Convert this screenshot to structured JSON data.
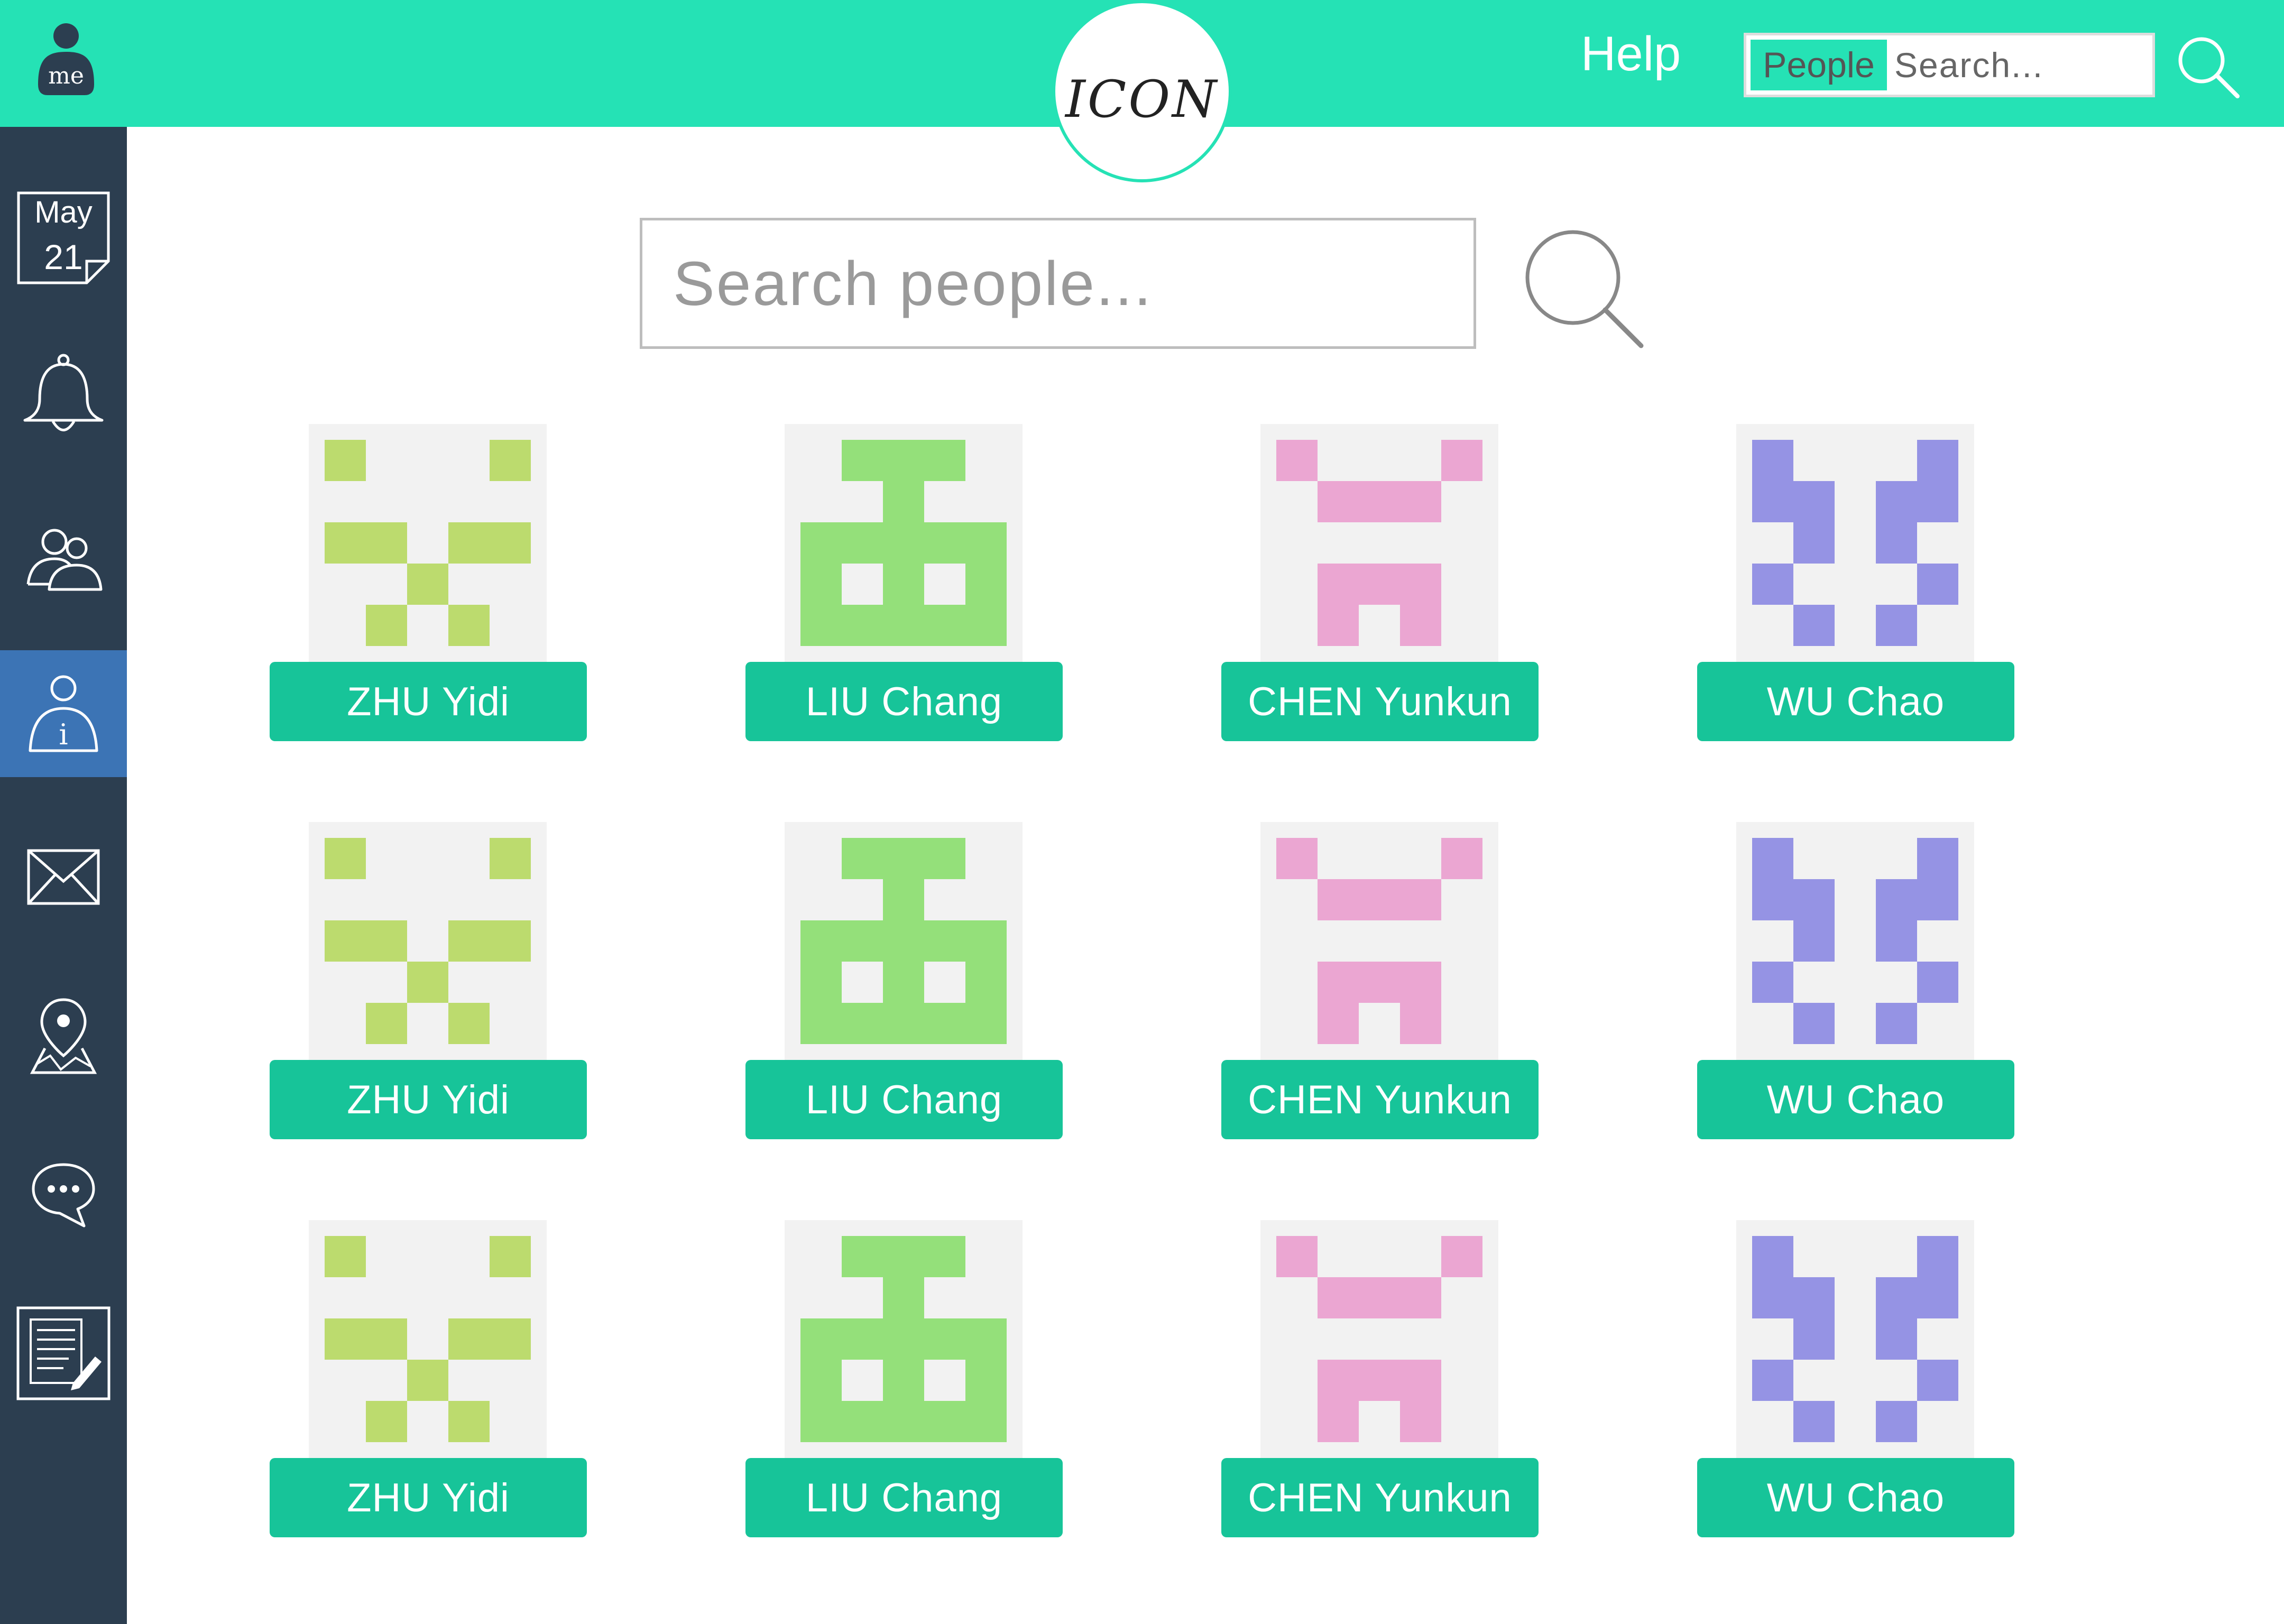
{
  "header": {
    "avatar_label": "me",
    "logo_text": "ICON",
    "help_label": "Help",
    "search": {
      "scope": "People",
      "placeholder": "Search..."
    }
  },
  "sidebar": {
    "calendar": {
      "month": "May",
      "day": "21"
    },
    "items": [
      {
        "icon": "calendar-icon",
        "active": false
      },
      {
        "icon": "bell-icon",
        "active": false
      },
      {
        "icon": "people-icon",
        "active": false
      },
      {
        "icon": "person-info-icon",
        "active": true
      },
      {
        "icon": "mail-icon",
        "active": false
      },
      {
        "icon": "map-pin-icon",
        "active": false
      },
      {
        "icon": "chat-icon",
        "active": false
      },
      {
        "icon": "edit-document-icon",
        "active": false
      }
    ]
  },
  "main": {
    "search_placeholder": "Search people...",
    "people_rows": [
      [
        {
          "name": "ZHU Yidi"
        },
        {
          "name": "LIU Chang"
        },
        {
          "name": "CHEN Yunkun"
        },
        {
          "name": "WU Chao"
        }
      ],
      [
        {
          "name": "ZHU Yidi"
        },
        {
          "name": "LIU Chang"
        },
        {
          "name": "CHEN Yunkun"
        },
        {
          "name": "WU Chao"
        }
      ],
      [
        {
          "name": "ZHU Yidi"
        },
        {
          "name": "LIU Chang"
        },
        {
          "name": "CHEN Yunkun"
        },
        {
          "name": "WU Chao"
        }
      ]
    ]
  },
  "colors": {
    "header_bg": "#25e2b5",
    "sidebar_bg": "#2c3e50",
    "sidebar_active": "#3c74b5",
    "name_button": "#17c499",
    "avatar_bg": "#f2f2f2",
    "identicon_zhu": "#bcdb6e",
    "identicon_liu": "#94e07a",
    "identicon_chen": "#eba6d2",
    "identicon_wu": "#9593e4"
  }
}
